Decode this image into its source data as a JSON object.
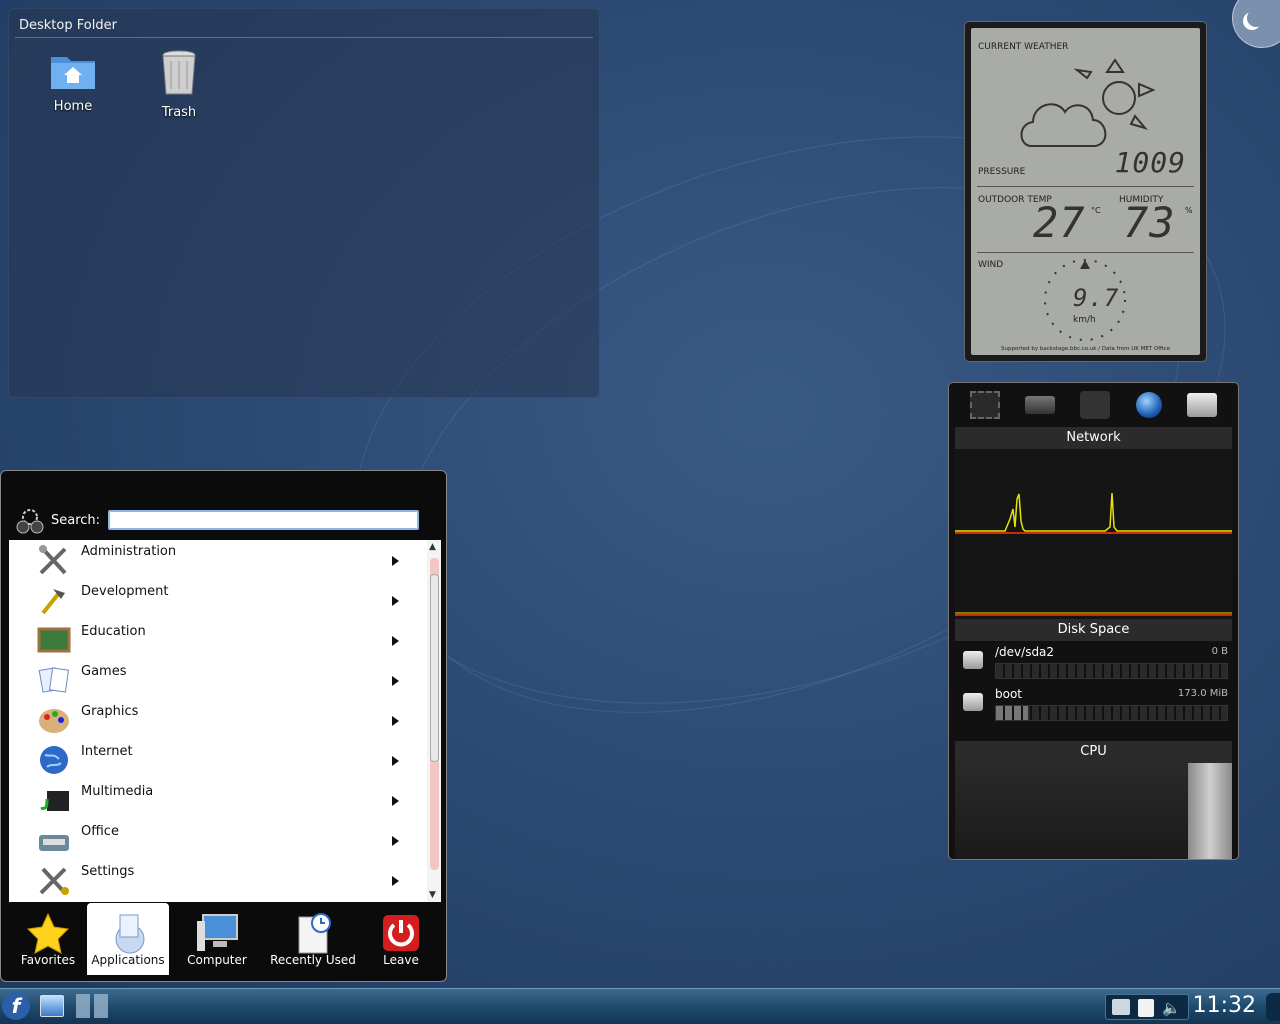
{
  "desktop_folder": {
    "title": "Desktop Folder",
    "icons": [
      {
        "label": "Home",
        "icon": "home-folder-icon"
      },
      {
        "label": "Trash",
        "icon": "trash-icon"
      }
    ]
  },
  "weather": {
    "heading": "CURRENT WEATHER",
    "pressure_label": "PRESSURE",
    "pressure": "1009",
    "outdoor_label": "OUTDOOR TEMP",
    "outdoor_temp": "27",
    "temp_unit": "°C",
    "humidity_label": "HUMIDITY",
    "humidity": "73",
    "humidity_unit": "%",
    "wind_label": "WIND",
    "wind_speed": "9.7",
    "wind_unit": "km/h",
    "credit": "Supported by backstage.bbc.co.uk / Data from UK MET Office"
  },
  "monitor": {
    "network_title": "Network",
    "disk_title": "Disk Space",
    "cpu_title": "CPU",
    "disks": [
      {
        "name": "/dev/sda2",
        "size": "0 B",
        "used_fraction": 0.0
      },
      {
        "name": "boot",
        "size": "173.0 MiB",
        "used_fraction": 0.14
      }
    ]
  },
  "kickoff": {
    "search_label": "Search:",
    "search_value": "",
    "categories": [
      {
        "label": "Administration",
        "icon": "administration-icon"
      },
      {
        "label": "Development",
        "icon": "development-icon"
      },
      {
        "label": "Education",
        "icon": "education-icon"
      },
      {
        "label": "Games",
        "icon": "games-icon"
      },
      {
        "label": "Graphics",
        "icon": "graphics-icon"
      },
      {
        "label": "Internet",
        "icon": "internet-icon"
      },
      {
        "label": "Multimedia",
        "icon": "multimedia-icon"
      },
      {
        "label": "Office",
        "icon": "office-icon"
      },
      {
        "label": "Settings",
        "icon": "settings-icon"
      }
    ],
    "tabs": [
      {
        "label": "Favorites",
        "icon": "star-icon",
        "active": false
      },
      {
        "label": "Applications",
        "icon": "applications-icon",
        "active": true
      },
      {
        "label": "Computer",
        "icon": "computer-icon",
        "active": false
      },
      {
        "label": "Recently Used",
        "icon": "recently-used-icon",
        "active": false
      },
      {
        "label": "Leave",
        "icon": "power-icon",
        "active": false
      }
    ]
  },
  "taskbar": {
    "clock": "11:32"
  },
  "colors": {
    "desktop_bg": "#2c4a74",
    "lcd": "#a9aba6",
    "graph_line": "#e4e400",
    "graph_base": "#c83000",
    "taskbar": "#1f4a6c"
  }
}
